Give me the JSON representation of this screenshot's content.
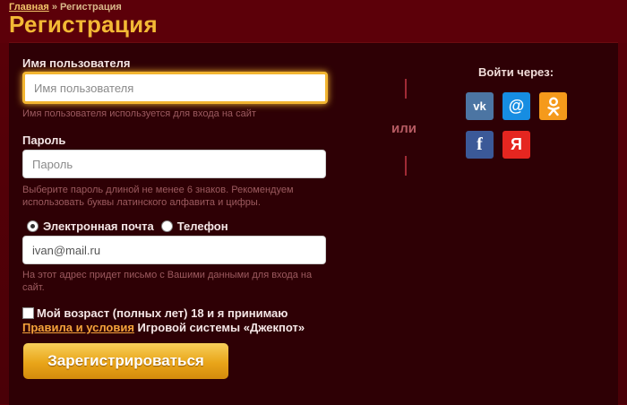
{
  "breadcrumb": {
    "home": "Главная",
    "separator": "»",
    "current": "Регистрация"
  },
  "page_title": "Регистрация",
  "username": {
    "label": "Имя пользователя",
    "placeholder": "Имя пользователя",
    "hint": "Имя пользователя используется для входа на сайт"
  },
  "password": {
    "label": "Пароль",
    "placeholder": "Пароль",
    "hint_line1": "Выберите пароль длиной не менее 6 знаков. Рекомендуем",
    "hint_line2": "использовать буквы латинского алфавита и цифры."
  },
  "contact": {
    "option_email": "Электронная почта",
    "option_phone": "Телефон",
    "selected": "Электронная почта",
    "value": "ivan@mail.ru",
    "hint_line1": "На этот адрес придет письмо с Вашими данными для входа на",
    "hint_line2": "сайт."
  },
  "agreement": {
    "line1": "Мой возраст (полных лет) 18 и я принимаю",
    "rules_link": "Правила и условия",
    "line2_rest": " Игровой системы «Джекпот»"
  },
  "register_button": "Зарегистрироваться",
  "or_text": "или",
  "social": {
    "title": "Войти через:",
    "vk": "vk",
    "mail": "@",
    "fb": "f",
    "ya": "Я"
  },
  "colors": {
    "accent": "#f3b935",
    "link": "#f5a33b",
    "background": "#5a0008",
    "panel": "#2e0005"
  }
}
